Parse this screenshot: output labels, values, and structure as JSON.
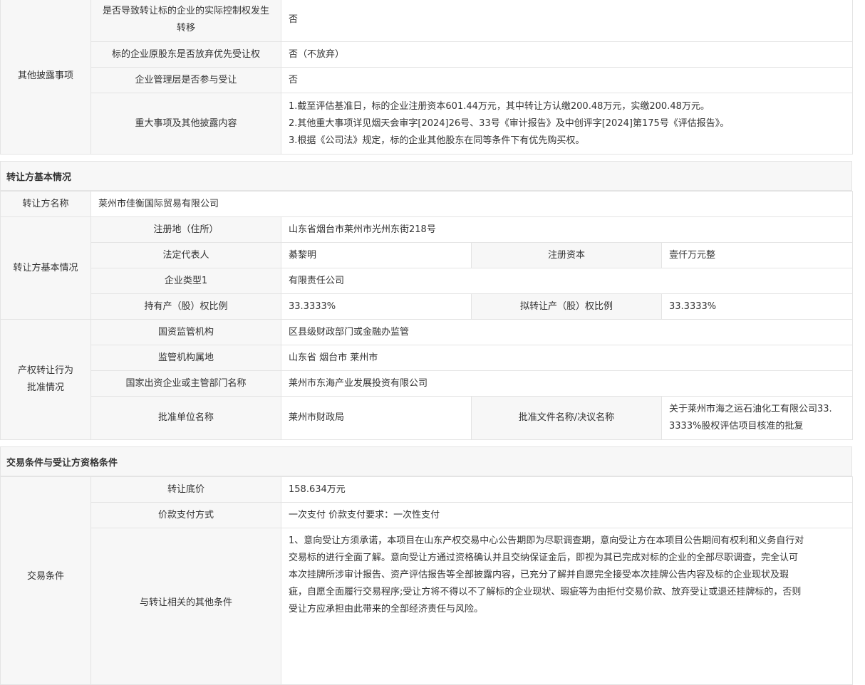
{
  "other_disclosure": {
    "group": "其他披露事项",
    "rows": [
      {
        "label": "是否导致转让标的企业的实际控制权发生转移",
        "value": "否"
      },
      {
        "label": "标的企业原股东是否放弃优先受让权",
        "value": "否（不放弃）"
      },
      {
        "label": "企业管理层是否参与受让",
        "value": "否"
      },
      {
        "label": "重大事项及其他披露内容",
        "lines": [
          "1.截至评估基准日，标的企业注册资本601.44万元，其中转让方认缴200.48万元，实缴200.48万元。",
          "2.其他重大事项详见烟天会审字[2024]26号、33号《审计报告》及中创评字[2024]第175号《评估报告》。",
          "3.根据《公司法》规定，标的企业其他股东在同等条件下有优先购买权。"
        ]
      }
    ]
  },
  "transferor": {
    "section_title": "转让方基本情况",
    "name_label": "转让方名称",
    "name_value": "莱州市佳衡国际贸易有限公司",
    "group": "转让方基本情况",
    "reg_address_label": "注册地（住所）",
    "reg_address_value": "山东省烟台市莱州市光州东街218号",
    "legal_rep_label": "法定代表人",
    "legal_rep_value": "綦黎明",
    "reg_capital_label": "注册资本",
    "reg_capital_value": "壹仟万元整",
    "company_type_label": "企业类型1",
    "company_type_value": "有限责任公司",
    "hold_ratio_label": "持有产（股）权比例",
    "hold_ratio_value": "33.3333%",
    "transfer_ratio_label": "拟转让产（股）权比例",
    "transfer_ratio_value": "33.3333%"
  },
  "approval": {
    "group_line1": "产权转让行为",
    "group_line2": "批准情况",
    "regulator_label": "国资监管机构",
    "regulator_value": "区县级财政部门或金融办监管",
    "region_label": "监管机构属地",
    "region_value": "山东省 烟台市 莱州市",
    "parent_label": "国家出资企业或主管部门名称",
    "parent_value": "莱州市东海产业发展投资有限公司",
    "unit_label": "批准单位名称",
    "unit_value": "莱州市财政局",
    "doc_label": "批准文件名称/决议名称",
    "doc_line1": "关于莱州市海之运石油化工有限公司33.",
    "doc_line2": "3333%股权评估项目核准的批复"
  },
  "conditions": {
    "section_title": "交易条件与受让方资格条件",
    "group": "交易条件",
    "price_label": "转让底价",
    "price_value": "158.634万元",
    "payment_label": "价款支付方式",
    "payment_value": "一次支付 价款支付要求：一次性支付",
    "other_label": "与转让相关的其他条件",
    "other_lines": [
      "1、意向受让方须承诺，本项目在山东产权交易中心公告期即为尽职调查期，意向受让方在本项目公告期间有权利和义务自行对",
      "交易标的进行全面了解。意向受让方通过资格确认并且交纳保证金后，即视为其已完成对标的企业的全部尽职调查，完全认可",
      "本次挂牌所涉审计报告、资产评估报告等全部披露内容，已充分了解并自愿完全接受本次挂牌公告内容及标的企业现状及瑕",
      "疵，自愿全面履行交易程序;受让方将不得以不了解标的企业现状、瑕疵等为由拒付交易价款、放弃受让或退还挂牌标的，否则",
      "受让方应承担由此带来的全部经济责任与风险。"
    ]
  }
}
